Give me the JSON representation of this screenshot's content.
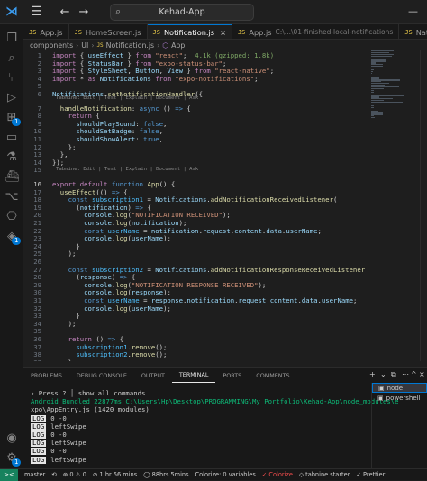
{
  "titlebar": {
    "menu_icon": "hamburger-icon",
    "search_text": "Kehad-App",
    "minimize": "—"
  },
  "activity_bar": {
    "icons": [
      "files-icon",
      "search-icon",
      "source-control-icon",
      "run-debug-icon",
      "extensions-icon",
      "remote-explorer-icon",
      "testing-icon",
      "docker-icon",
      "git-graph-icon",
      "source-graph-icon",
      "account-icon",
      "settings-icon"
    ],
    "source_control_badge": "1",
    "remote_badge": "1",
    "settings_badge": "1"
  },
  "tabs": [
    {
      "label": "App.js",
      "icon": "JS",
      "active": false
    },
    {
      "label": "HomeScreen.js",
      "icon": "JS",
      "active": false
    },
    {
      "label": "Notification.js",
      "icon": "JS",
      "active": true,
      "close": "×"
    },
    {
      "label": "App.js",
      "icon": "JS",
      "path": "C:\\...\\01-finished-local-notifications",
      "active": false
    },
    {
      "label": "NativeScreen.js",
      "icon": "JS",
      "active": false
    }
  ],
  "breadcrumb": [
    "components",
    "UI",
    "Notification.js",
    "App"
  ],
  "code_lens": {
    "first": "Tabnine: Edit | Test | Explain | Document | Ask",
    "second": "Tabnine: Edit | Test | Explain | Document | Ask"
  },
  "code_lines": [
    {
      "n": "1",
      "code": [
        [
          "kw",
          "import "
        ],
        [
          "pc",
          "{ "
        ],
        [
          "vr",
          "useEffect"
        ],
        [
          "pc",
          " } "
        ],
        [
          "kw",
          "from "
        ],
        [
          "st",
          "\"react\""
        ],
        [
          "pc",
          ";  "
        ],
        [
          "gz",
          "4.1k (gzipped: 1.8k)"
        ]
      ]
    },
    {
      "n": "2",
      "code": [
        [
          "kw",
          "import "
        ],
        [
          "pc",
          "{ "
        ],
        [
          "vr",
          "StatusBar"
        ],
        [
          "pc",
          " } "
        ],
        [
          "kw",
          "from "
        ],
        [
          "st",
          "\"expo-status-bar\""
        ],
        [
          "pc",
          ";"
        ]
      ]
    },
    {
      "n": "3",
      "code": [
        [
          "kw",
          "import "
        ],
        [
          "pc",
          "{ "
        ],
        [
          "vr",
          "StyleSheet"
        ],
        [
          "pc",
          ", "
        ],
        [
          "vr",
          "Button"
        ],
        [
          "pc",
          ", "
        ],
        [
          "vr",
          "View"
        ],
        [
          "pc",
          " } "
        ],
        [
          "kw",
          "from "
        ],
        [
          "st",
          "\"react-native\""
        ],
        [
          "pc",
          ";"
        ]
      ]
    },
    {
      "n": "4",
      "code": [
        [
          "kw",
          "import "
        ],
        [
          "pc",
          "* "
        ],
        [
          "kw",
          "as "
        ],
        [
          "vr",
          "Notifications"
        ],
        [
          "pc",
          " "
        ],
        [
          "kw",
          "from "
        ],
        [
          "st",
          "\"expo-notifications\""
        ],
        [
          "pc",
          ";"
        ]
      ]
    },
    {
      "n": "5",
      "code": []
    },
    {
      "n": "6",
      "code": [
        [
          "vr",
          "Notifications"
        ],
        [
          "pc",
          "."
        ],
        [
          "fn",
          "setNotificationHandler"
        ],
        [
          "pc",
          "({"
        ]
      ]
    },
    {
      "n": "7",
      "code": [
        [
          "pc",
          "  "
        ],
        [
          "fn",
          "handleNotification"
        ],
        [
          "pc",
          ": "
        ],
        [
          "kb",
          "async"
        ],
        [
          "pc",
          " () "
        ],
        [
          "kb",
          "=>"
        ],
        [
          "pc",
          " {"
        ]
      ]
    },
    {
      "n": "8",
      "code": [
        [
          "pc",
          "    "
        ],
        [
          "kw",
          "return"
        ],
        [
          "pc",
          " {"
        ]
      ]
    },
    {
      "n": "9",
      "code": [
        [
          "pc",
          "      "
        ],
        [
          "vr",
          "shouldPlaySound"
        ],
        [
          "pc",
          ": "
        ],
        [
          "kb",
          "false"
        ],
        [
          "pc",
          ","
        ]
      ]
    },
    {
      "n": "10",
      "code": [
        [
          "pc",
          "      "
        ],
        [
          "vr",
          "shouldSetBadge"
        ],
        [
          "pc",
          ": "
        ],
        [
          "kb",
          "false"
        ],
        [
          "pc",
          ","
        ]
      ]
    },
    {
      "n": "11",
      "code": [
        [
          "pc",
          "      "
        ],
        [
          "vr",
          "shouldShowAlert"
        ],
        [
          "pc",
          ": "
        ],
        [
          "kb",
          "true"
        ],
        [
          "pc",
          ","
        ]
      ]
    },
    {
      "n": "12",
      "code": [
        [
          "pc",
          "    };"
        ]
      ]
    },
    {
      "n": "13",
      "code": [
        [
          "pc",
          "  },"
        ]
      ]
    },
    {
      "n": "14",
      "code": [
        [
          "pc",
          "});"
        ]
      ]
    },
    {
      "n": "15",
      "code": []
    },
    {
      "n": "16",
      "code": [
        [
          "kw",
          "export "
        ],
        [
          "kw",
          "default "
        ],
        [
          "kb",
          "function "
        ],
        [
          "fn",
          "App"
        ],
        [
          "pc",
          "() {"
        ]
      ]
    },
    {
      "n": "17",
      "code": [
        [
          "pc",
          "  "
        ],
        [
          "fn",
          "useEffect"
        ],
        [
          "pc",
          "(() "
        ],
        [
          "kb",
          "=>"
        ],
        [
          "pc",
          " {"
        ]
      ]
    },
    {
      "n": "18",
      "code": [
        [
          "pc",
          "    "
        ],
        [
          "kb",
          "const "
        ],
        [
          "cn",
          "subscription1"
        ],
        [
          "pc",
          " = "
        ],
        [
          "vr",
          "Notifications"
        ],
        [
          "pc",
          "."
        ],
        [
          "fn",
          "addNotificationReceivedListener"
        ],
        [
          "pc",
          "("
        ]
      ]
    },
    {
      "n": "19",
      "code": [
        [
          "pc",
          "      ("
        ],
        [
          "vr",
          "notification"
        ],
        [
          "pc",
          ") "
        ],
        [
          "kb",
          "=>"
        ],
        [
          "pc",
          " {"
        ]
      ]
    },
    {
      "n": "20",
      "code": [
        [
          "pc",
          "        "
        ],
        [
          "vr",
          "console"
        ],
        [
          "pc",
          "."
        ],
        [
          "fn",
          "log"
        ],
        [
          "pc",
          "("
        ],
        [
          "st",
          "\"NOTIFICATION RECEIVED\""
        ],
        [
          "pc",
          ");"
        ]
      ]
    },
    {
      "n": "21",
      "code": [
        [
          "pc",
          "        "
        ],
        [
          "vr",
          "console"
        ],
        [
          "pc",
          "."
        ],
        [
          "fn",
          "log"
        ],
        [
          "pc",
          "("
        ],
        [
          "vr",
          "notification"
        ],
        [
          "pc",
          ");"
        ]
      ]
    },
    {
      "n": "22",
      "code": [
        [
          "pc",
          "        "
        ],
        [
          "kb",
          "const "
        ],
        [
          "cn",
          "userName"
        ],
        [
          "pc",
          " = "
        ],
        [
          "vr",
          "notification"
        ],
        [
          "pc",
          "."
        ],
        [
          "vr",
          "request"
        ],
        [
          "pc",
          "."
        ],
        [
          "vr",
          "content"
        ],
        [
          "pc",
          "."
        ],
        [
          "vr",
          "data"
        ],
        [
          "pc",
          "."
        ],
        [
          "vr",
          "userName"
        ],
        [
          "pc",
          ";"
        ]
      ]
    },
    {
      "n": "23",
      "code": [
        [
          "pc",
          "        "
        ],
        [
          "vr",
          "console"
        ],
        [
          "pc",
          "."
        ],
        [
          "fn",
          "log"
        ],
        [
          "pc",
          "("
        ],
        [
          "vr",
          "userName"
        ],
        [
          "pc",
          ");"
        ]
      ]
    },
    {
      "n": "24",
      "code": [
        [
          "pc",
          "      }"
        ]
      ]
    },
    {
      "n": "25",
      "code": [
        [
          "pc",
          "    );"
        ]
      ]
    },
    {
      "n": "26",
      "code": []
    },
    {
      "n": "27",
      "code": [
        [
          "pc",
          "    "
        ],
        [
          "kb",
          "const "
        ],
        [
          "cn",
          "subscription2"
        ],
        [
          "pc",
          " = "
        ],
        [
          "vr",
          "Notifications"
        ],
        [
          "pc",
          "."
        ],
        [
          "fn",
          "addNotificationResponseReceivedListener"
        ],
        [
          "pc",
          "("
        ]
      ]
    },
    {
      "n": "28",
      "code": [
        [
          "pc",
          "      ("
        ],
        [
          "vr",
          "response"
        ],
        [
          "pc",
          ") "
        ],
        [
          "kb",
          "=>"
        ],
        [
          "pc",
          " {"
        ]
      ]
    },
    {
      "n": "29",
      "code": [
        [
          "pc",
          "        "
        ],
        [
          "vr",
          "console"
        ],
        [
          "pc",
          "."
        ],
        [
          "fn",
          "log"
        ],
        [
          "pc",
          "("
        ],
        [
          "st",
          "\"NOTIFICATION RESPONSE RECEIVED\""
        ],
        [
          "pc",
          ");"
        ]
      ]
    },
    {
      "n": "30",
      "code": [
        [
          "pc",
          "        "
        ],
        [
          "vr",
          "console"
        ],
        [
          "pc",
          "."
        ],
        [
          "fn",
          "log"
        ],
        [
          "pc",
          "("
        ],
        [
          "vr",
          "response"
        ],
        [
          "pc",
          ");"
        ]
      ]
    },
    {
      "n": "31",
      "code": [
        [
          "pc",
          "        "
        ],
        [
          "kb",
          "const "
        ],
        [
          "cn",
          "userName"
        ],
        [
          "pc",
          " = "
        ],
        [
          "vr",
          "response"
        ],
        [
          "pc",
          "."
        ],
        [
          "vr",
          "notification"
        ],
        [
          "pc",
          "."
        ],
        [
          "vr",
          "request"
        ],
        [
          "pc",
          "."
        ],
        [
          "vr",
          "content"
        ],
        [
          "pc",
          "."
        ],
        [
          "vr",
          "data"
        ],
        [
          "pc",
          "."
        ],
        [
          "vr",
          "userName"
        ],
        [
          "pc",
          ";"
        ]
      ]
    },
    {
      "n": "32",
      "code": [
        [
          "pc",
          "        "
        ],
        [
          "vr",
          "console"
        ],
        [
          "pc",
          "."
        ],
        [
          "fn",
          "log"
        ],
        [
          "pc",
          "("
        ],
        [
          "vr",
          "userName"
        ],
        [
          "pc",
          ");"
        ]
      ]
    },
    {
      "n": "33",
      "code": [
        [
          "pc",
          "      }"
        ]
      ]
    },
    {
      "n": "34",
      "code": [
        [
          "pc",
          "    );"
        ]
      ]
    },
    {
      "n": "35",
      "code": []
    },
    {
      "n": "36",
      "code": [
        [
          "pc",
          "    "
        ],
        [
          "kw",
          "return"
        ],
        [
          "pc",
          " () "
        ],
        [
          "kb",
          "=>"
        ],
        [
          "pc",
          " {"
        ]
      ]
    },
    {
      "n": "37",
      "code": [
        [
          "pc",
          "      "
        ],
        [
          "cn",
          "subscription1"
        ],
        [
          "pc",
          "."
        ],
        [
          "fn",
          "remove"
        ],
        [
          "pc",
          "();"
        ]
      ]
    },
    {
      "n": "38",
      "code": [
        [
          "pc",
          "      "
        ],
        [
          "cn",
          "subscription2"
        ],
        [
          "pc",
          "."
        ],
        [
          "fn",
          "remove"
        ],
        [
          "pc",
          "();"
        ]
      ]
    },
    {
      "n": "39",
      "code": [
        [
          "pc",
          "    };"
        ]
      ]
    },
    {
      "n": "40",
      "code": [
        [
          "pc",
          "  }, []);"
        ]
      ]
    },
    {
      "n": "41",
      "code": []
    }
  ],
  "panel": {
    "tabs": [
      "PROBLEMS",
      "DEBUG CONSOLE",
      "OUTPUT",
      "TERMINAL",
      "PORTS",
      "COMMENTS"
    ],
    "active_tab": "TERMINAL",
    "controls": [
      "+",
      "⌄",
      "⧉",
      "⋯",
      "^",
      "×"
    ],
    "terminal_lines": [
      {
        "type": "plain",
        "text": "› Press ? │ show all commands"
      },
      {
        "type": "green",
        "text": "Android Bundled 22877ms C:\\Users\\Hp\\Desktop\\PROGRAMMING\\My Portfolio\\Kehad-App\\node_modules\\e"
      },
      {
        "type": "plain",
        "text": "xpo\\AppEntry.js (1420 modules)"
      },
      {
        "type": "log",
        "text": "0 -0"
      },
      {
        "type": "log",
        "text": "leftSwipe"
      },
      {
        "type": "log",
        "text": "0 -0"
      },
      {
        "type": "log",
        "text": "leftSwipe"
      },
      {
        "type": "log",
        "text": "0 -0"
      },
      {
        "type": "log",
        "text": "leftSwipe"
      }
    ],
    "log_label": "LOG",
    "terminals": [
      {
        "label": "node",
        "active": true
      },
      {
        "label": "powershell",
        "active": false
      }
    ]
  },
  "statusbar": {
    "remote": "><",
    "items": [
      "master",
      "⟲",
      "⊗ 0 ⚠ 0",
      "⊘ 1 hr 56 mins",
      "◯ 88hrs 5mins",
      "Colorize: 0 variables",
      "✓ Colorize",
      "◇ tabnine starter",
      "✓ Prettier"
    ],
    "error_item_index": 6
  }
}
